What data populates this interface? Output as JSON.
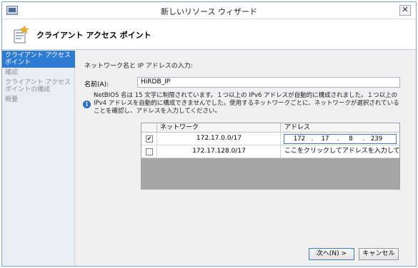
{
  "window": {
    "title": "新しいリソース ウィザード",
    "close_glyph": "✕"
  },
  "header": {
    "title": "クライアント アクセス ポイント",
    "icon": "wizard-star-icon"
  },
  "nav": {
    "items": [
      {
        "label": "クライアント アクセス ポイント",
        "active": true
      },
      {
        "label": "確認",
        "active": false
      },
      {
        "label": "クライアント アクセス ポイントの構成",
        "active": false
      },
      {
        "label": "概要",
        "active": false
      }
    ]
  },
  "content": {
    "section_label": "ネットワーク名と IP アドレスの入力:",
    "name_label": "名前(A):",
    "name_value": "HiRDB_IP",
    "info_icon": "info-icon",
    "info_text": "NetBIOS 名は 15 文字に制限されています。１つ以上の IPv6 アドレスが自動的に構成されました。１つ以上の IPv4 アドレスを自動的に構成できませんでした。使用するネットワークごとに、ネットワークが選択されていることを確認し、アドレスを入力してください。"
  },
  "grid": {
    "columns": [
      "",
      "ネットワーク",
      "アドレス"
    ],
    "rows": [
      {
        "checked": true,
        "network": "172.17.0.0/17",
        "address_octets": [
          "172",
          "17",
          "8",
          "239"
        ]
      },
      {
        "checked": false,
        "network": "172.17.128.0/17",
        "address_text": "ここをクリックしてアドレスを入力してくださ..."
      }
    ]
  },
  "buttons": {
    "next": "次へ(N) >",
    "cancel": "キャンセル"
  },
  "colors": {
    "nav_active": "#2e7bd4",
    "grid_empty": "#a6a6a6",
    "window_border": "#7aa7d4"
  }
}
